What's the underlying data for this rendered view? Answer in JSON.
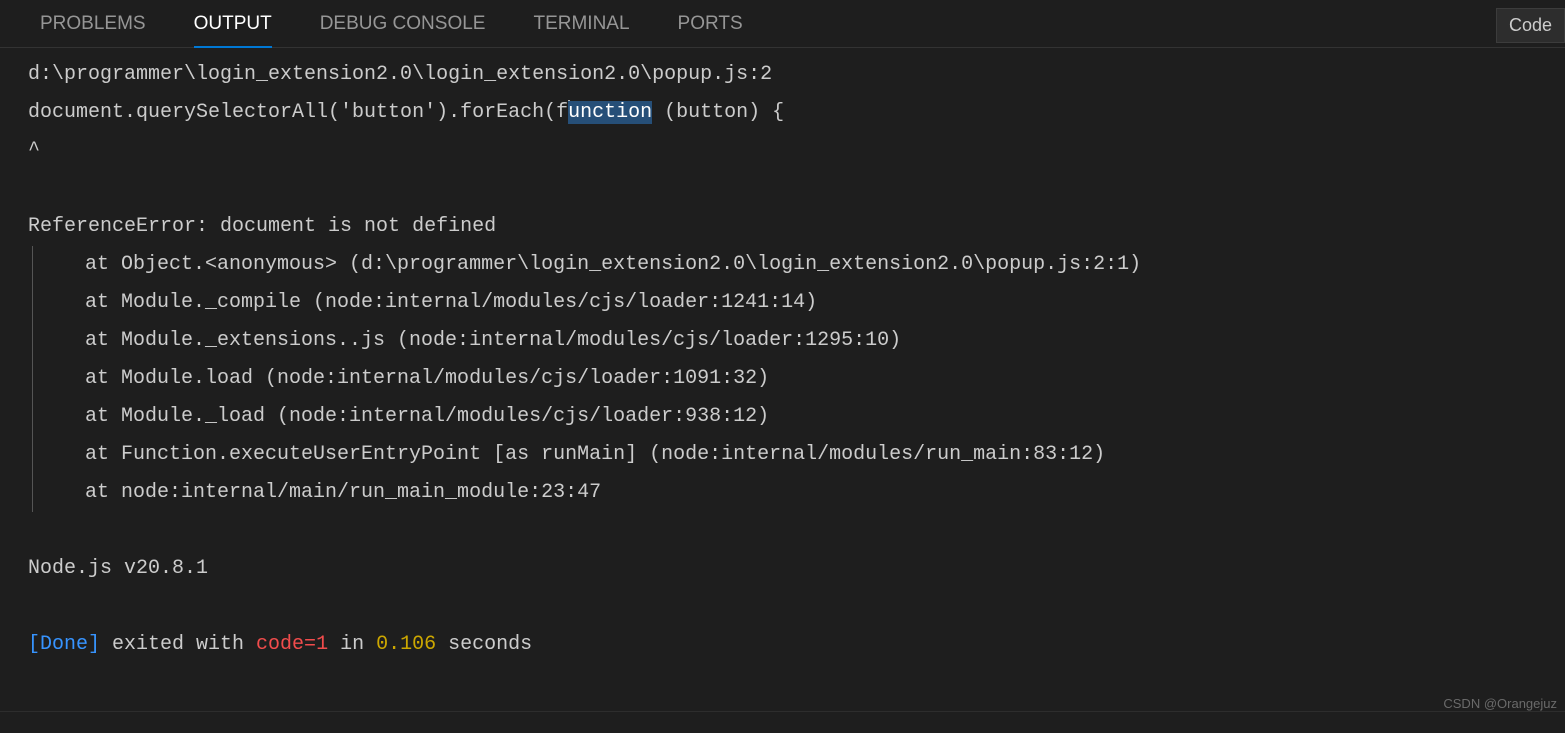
{
  "tabs": {
    "problems": "PROBLEMS",
    "output": "OUTPUT",
    "debug_console": "DEBUG CONSOLE",
    "terminal": "TERMINAL",
    "ports": "PORTS"
  },
  "code_button": "Code",
  "output": {
    "file_path": "d:\\programmer\\login_extension2.0\\login_extension2.0\\popup.js:2",
    "code_line_pre": "document.querySelectorAll('button').forEach(f",
    "code_line_highlight": "unction",
    "code_line_post": " (button) {",
    "caret": "^",
    "error_header": "ReferenceError: document is not defined",
    "stack": [
      "at Object.<anonymous> (d:\\programmer\\login_extension2.0\\login_extension2.0\\popup.js:2:1)",
      "at Module._compile (node:internal/modules/cjs/loader:1241:14)",
      "at Module._extensions..js (node:internal/modules/cjs/loader:1295:10)",
      "at Module.load (node:internal/modules/cjs/loader:1091:32)",
      "at Module._load (node:internal/modules/cjs/loader:938:12)",
      "at Function.executeUserEntryPoint [as runMain] (node:internal/modules/run_main:83:12)",
      "at node:internal/main/run_main_module:23:47"
    ],
    "node_version": "Node.js v20.8.1",
    "done_bracket": "[Done]",
    "exited_text": " exited with ",
    "code_text": "code=",
    "code_value": "1",
    "in_text": " in ",
    "time_value": "0.106",
    "seconds_text": " seconds"
  },
  "watermark": "CSDN @Orangejuz"
}
